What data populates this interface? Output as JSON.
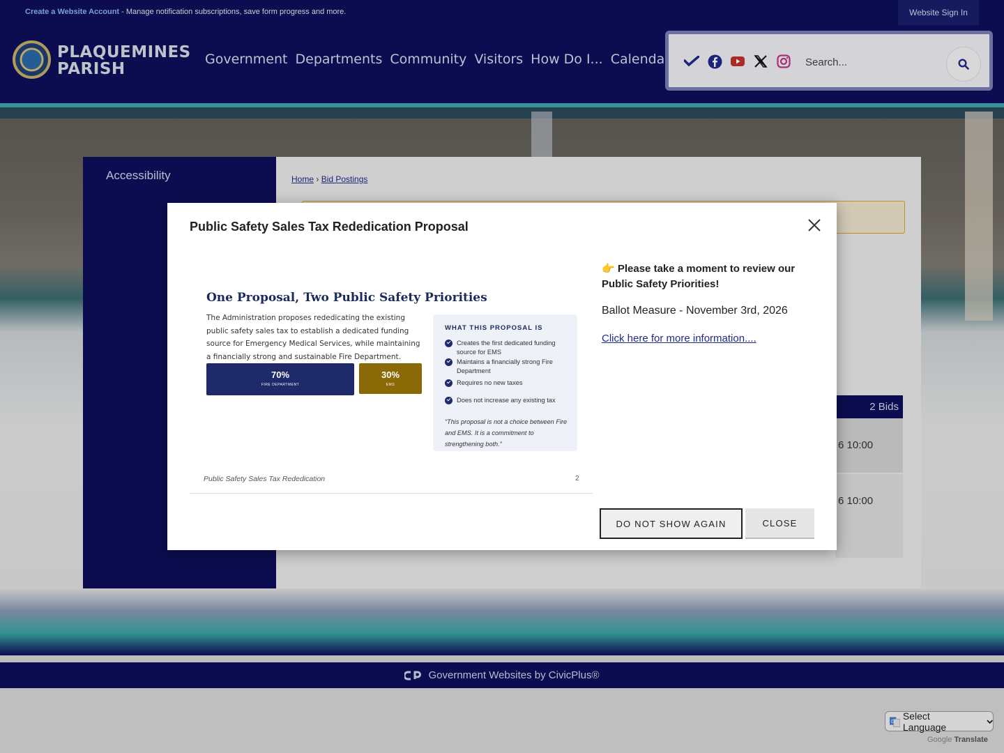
{
  "topbar": {
    "create_account_link": "Create a Website Account",
    "create_account_desc": " - Manage notification subscriptions, save form progress and more.",
    "sign_in": "Website Sign In"
  },
  "header": {
    "logo_line1": "PLAQUEMINES",
    "logo_line2": "PARISH",
    "nav": [
      "Government",
      "Departments",
      "Community",
      "Visitors",
      "How Do I...",
      "Calendar"
    ],
    "social_icons": [
      "nextdoor-icon",
      "facebook-icon",
      "youtube-icon",
      "x-icon",
      "instagram-icon"
    ],
    "search_placeholder": "Search..."
  },
  "sidebar": {
    "items": [
      "Accessibility"
    ]
  },
  "breadcrumb": {
    "home": "Home",
    "separator": "›",
    "current": "Bid Postings"
  },
  "bids": {
    "count_label": "2 Bids",
    "rows": [
      "6 10:00",
      "6 10:00"
    ]
  },
  "modal": {
    "title": "Public Safety Sales Tax Rededication Proposal",
    "slide": {
      "heading": "One Proposal, Two Public Safety Priorities",
      "body": "The Administration proposes rededicating the existing public safety sales tax to establish a dedicated funding source for Emergency Medical Services, while maintaining a financially strong and sustainable Fire Department.",
      "bar1_pct": "70%",
      "bar1_label": "FIRE DEPARTMENT",
      "bar2_pct": "30%",
      "bar2_label": "EMS",
      "split_fraction": 0.7,
      "box_heading": "WHAT THIS PROPOSAL IS",
      "box_items": [
        "Creates the first dedicated funding source for EMS",
        "Maintains a financially strong Fire Department",
        "Requires no new taxes",
        "Does not increase any existing tax"
      ],
      "quote": "“This proposal is not a choice between Fire and EMS. It is a commitment to strengthening both.”",
      "footer": "Public Safety Sales Tax Rededication",
      "page": "2"
    },
    "review_icon": "👉",
    "review_text": "Please take a moment to review our Public Safety Priorities!",
    "ballot_text": "Ballot Measure - November 3rd, 2026",
    "more_info_link": "Click here for more information....",
    "btn_dont_show": "DO NOT SHOW AGAIN",
    "btn_close": "CLOSE"
  },
  "footer": {
    "credit": "Government Websites by CivicPlus®",
    "language_select": "Select Language",
    "powered_by": "Google",
    "translate": "Translate"
  },
  "colors": {
    "navy": "#0d0f5c",
    "fire_bar": "#1f2a6b",
    "ems_bar": "#8a6a06",
    "link": "#1f2a8a"
  }
}
